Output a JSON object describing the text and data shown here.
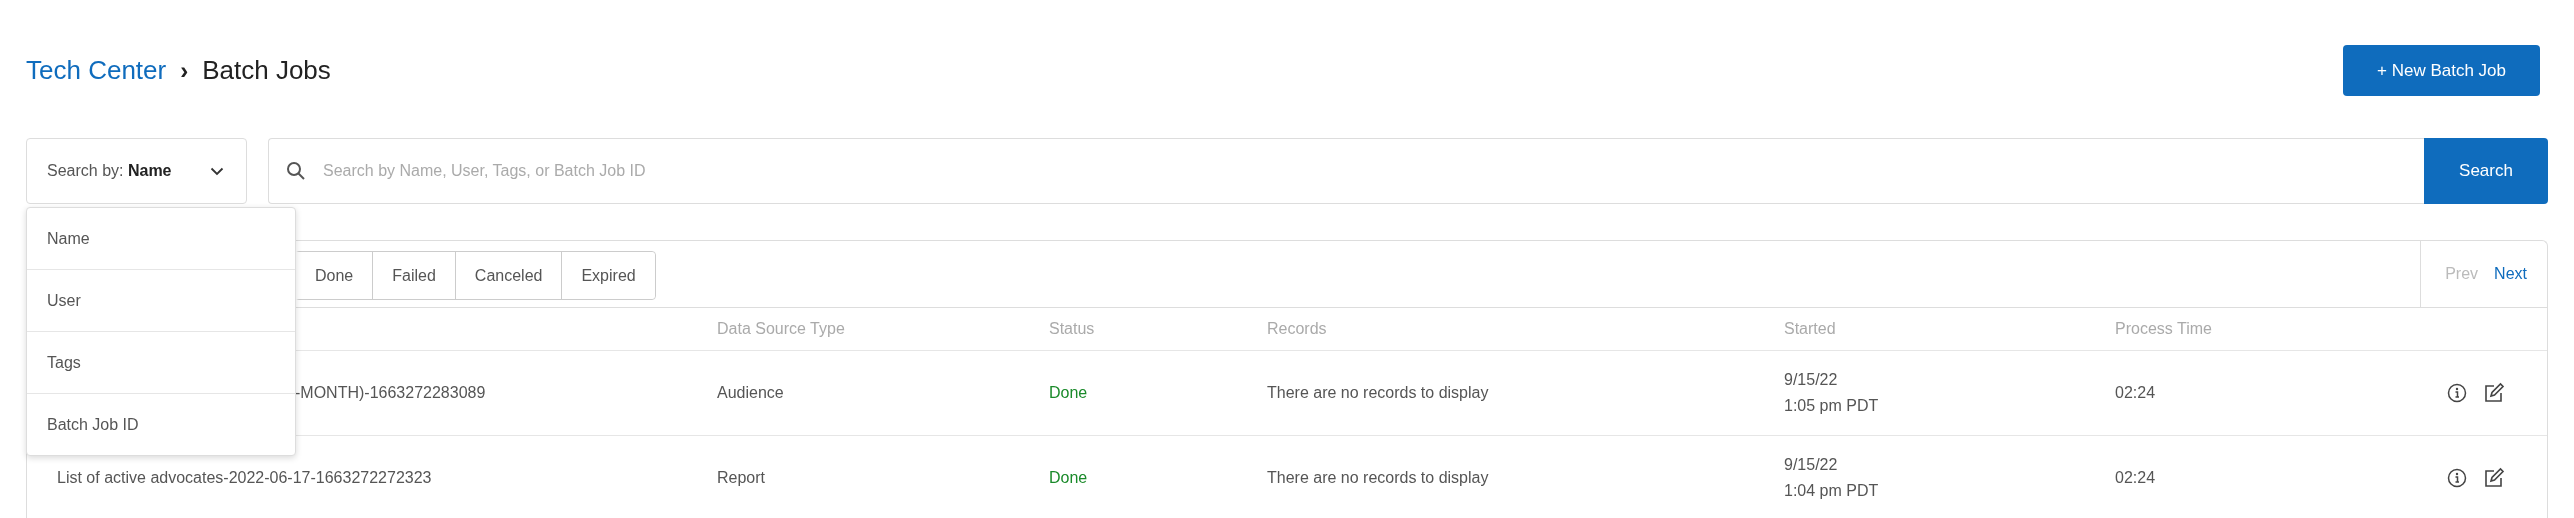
{
  "breadcrumb": {
    "parent": "Tech Center",
    "separator": "›",
    "current": "Batch Jobs"
  },
  "new_button": "+ New Batch Job",
  "search_by": {
    "label": "Search by: **Name**",
    "menu_open": true,
    "options": [
      "Name",
      "User",
      "Tags",
      "Batch Job ID"
    ]
  },
  "search": {
    "placeholder": "Search by Name, User, Tags, or Batch Job ID",
    "button": "Search"
  },
  "filter_tabs": [
    "Done",
    "Failed",
    "Canceled",
    "Expired"
  ],
  "pager": {
    "prev": {
      "label": "Prev",
      "disabled": true
    },
    "next": {
      "label": "Next",
      "disabled": false
    }
  },
  "table": {
    "columns": [
      "Data Source Type",
      "Status",
      "Records",
      "Started",
      "Process Time"
    ],
    "rows": [
      {
        "name": "-MONTH)-1663272283089",
        "covered": true,
        "data_source_type": "Audience",
        "status": "Done",
        "records": "There are no records to display",
        "started_date": "9/15/22",
        "started_time": "1:05 pm PDT",
        "process_time": "02:24"
      },
      {
        "name": "List of active advocates-2022-06-17-1663272272323",
        "covered": false,
        "data_source_type": "Report",
        "status": "Done",
        "records": "There are no records to display",
        "started_date": "9/15/22",
        "started_time": "1:04 pm PDT",
        "process_time": "02:24"
      }
    ]
  }
}
